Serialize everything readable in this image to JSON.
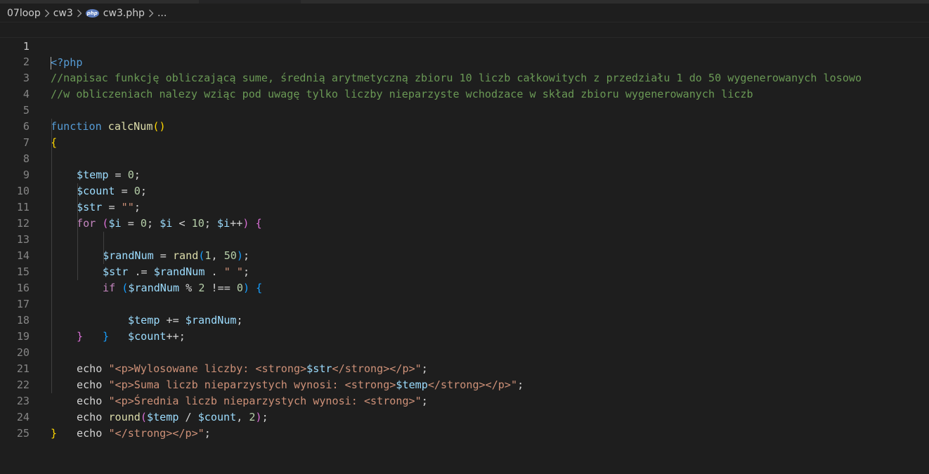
{
  "breadcrumb": {
    "folder1": "07loop",
    "folder2": "cw3",
    "file_icon": "php-file-icon",
    "file_icon_text": "php",
    "file": "cw3.php",
    "symbol": "...",
    "separator_icon": "chevron-right-icon"
  },
  "editor": {
    "active_line": 1,
    "language": "php",
    "theme_colors": {
      "background": "#1e1e1e",
      "keyword": "#569cd6",
      "control": "#c586c0",
      "function": "#dcdcaa",
      "variable": "#9cdcfe",
      "number": "#b5cea8",
      "string": "#ce9178",
      "comment": "#6a9955"
    },
    "line_numbers": [
      "1",
      "2",
      "3",
      "4",
      "5",
      "6",
      "7",
      "8",
      "9",
      "10",
      "11",
      "12",
      "13",
      "14",
      "15",
      "16",
      "17",
      "18",
      "19",
      "20",
      "21",
      "22",
      "23",
      "24",
      "25"
    ],
    "lines": {
      "l1": {
        "tag_open": "<",
        "tag_rest": "?php"
      },
      "l2": {
        "comment": "//napisac funkcję obliczającą sume, średnią arytmetyczną zbioru 10 liczb całkowitych z przedziału 1 do 50 wygenerowanych losowo"
      },
      "l3": {
        "comment": "//w obliczeniach nalezy wziąc pod uwagę tylko liczby nieparzyste wchodzace w skład zbioru wygenerowanych liczb"
      },
      "l5": {
        "kw": "function",
        "name": "calcNum",
        "open": "(",
        "close": ")"
      },
      "l6": {
        "brace": "{"
      },
      "l7": {
        "var": "$temp",
        "op": " = ",
        "num": "0",
        "end": ";"
      },
      "l8": {
        "var": "$count",
        "op": " = ",
        "num": "0",
        "end": ";"
      },
      "l9": {
        "var": "$str",
        "op": " = ",
        "str": "\"\"",
        "end": ";"
      },
      "l10": {
        "kw": "for",
        "sp": " ",
        "open": "(",
        "v1": "$i",
        "t1": " = ",
        "n1": "0",
        "t2": "; ",
        "v2": "$i",
        "t3": " < ",
        "n2": "10",
        "t4": "; ",
        "v3": "$i",
        "t5": "++",
        "close": ")",
        "t6": " ",
        "brace": "{"
      },
      "l11": {
        "var": "$randNum",
        "op": " = ",
        "fn": "rand",
        "open": "(",
        "n1": "1",
        "t1": ", ",
        "n2": "50",
        "close": ")",
        "end": ";"
      },
      "l12": {
        "var": "$str",
        "op": " .= ",
        "var2": "$randNum",
        "op2": " . ",
        "str": "\" \"",
        "end": ";"
      },
      "l13": {
        "kw": "if",
        "sp": " ",
        "open": "(",
        "var": "$randNum",
        "t1": " % ",
        "n1": "2",
        "t2": " !== ",
        "n2": "0",
        "close": ")",
        "t3": " ",
        "brace": "{"
      },
      "l14": {
        "var": "$temp",
        "op": " += ",
        "var2": "$randNum",
        "end": ";"
      },
      "l15": {
        "var": "$count",
        "op": "++;"
      },
      "l16": {
        "brace": "}"
      },
      "l17": {
        "brace": "}"
      },
      "l19": {
        "kw": "echo",
        "sp": " ",
        "s1": "\"<p>Wylosowane liczby: <strong>",
        "var": "$str",
        "s2": "</strong></p>\"",
        "end": ";"
      },
      "l20": {
        "kw": "echo",
        "sp": " ",
        "s1": "\"<p>Suma liczb nieparzystych wynosi: <strong>",
        "var": "$temp",
        "s2": "</strong></p>\"",
        "end": ";"
      },
      "l21": {
        "kw": "echo",
        "sp": " ",
        "s1": "\"<p>Średnia liczb nieparzystych wynosi: <strong>\"",
        "end": ";"
      },
      "l22": {
        "kw": "echo",
        "sp": " ",
        "fn": "round",
        "open": "(",
        "var": "$temp",
        "t1": " / ",
        "var2": "$count",
        "t2": ", ",
        "n1": "2",
        "close": ")",
        "end": ";"
      },
      "l23": {
        "kw": "echo",
        "sp": " ",
        "s1": "\"</strong></p>\"",
        "end": ";"
      },
      "l24": {
        "brace": "}"
      }
    }
  }
}
